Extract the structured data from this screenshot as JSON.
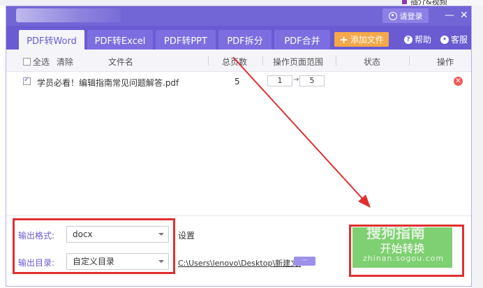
{
  "desktop_snippet": "插介&视频",
  "header": {
    "login_label": "请登录",
    "minimize": "—",
    "close": "✕"
  },
  "tabs": [
    {
      "label": "PDF转Word",
      "active": true
    },
    {
      "label": "PDF转Excel",
      "active": false
    },
    {
      "label": "PDF转PPT",
      "active": false
    },
    {
      "label": "PDF拆分",
      "active": false
    },
    {
      "label": "PDF合并",
      "active": false
    }
  ],
  "toolbar": {
    "add_file": "添加文件",
    "help": "帮助",
    "service": "客服"
  },
  "columns": {
    "select_all": "全选",
    "clear": "清除",
    "filename": "文件名",
    "total_pages": "总页数",
    "page_range": "操作页面范围",
    "status": "状态",
    "operation": "操作"
  },
  "files": [
    {
      "checked": true,
      "name": "学员必看！编辑指南常见问题解答.pdf",
      "pages": "5",
      "from": "1",
      "to": "5",
      "status": ""
    }
  ],
  "settings": {
    "format_label": "输出格式:",
    "format_value": "docx",
    "dir_label": "输出目录:",
    "dir_value": "自定义目录",
    "settings_link": "设置",
    "path": "C:\\Users\\lenovo\\Desktop\\新建文(",
    "browse": "···"
  },
  "start_button": "开始转换",
  "watermark": {
    "brand": "搜狗指南",
    "url": "zhinan.sogou.com"
  },
  "colors": {
    "brand": "#6a5bd2",
    "accent_orange": "#f5a84a",
    "start_green": "#7fd072",
    "annotation_red": "#e02f2f"
  }
}
